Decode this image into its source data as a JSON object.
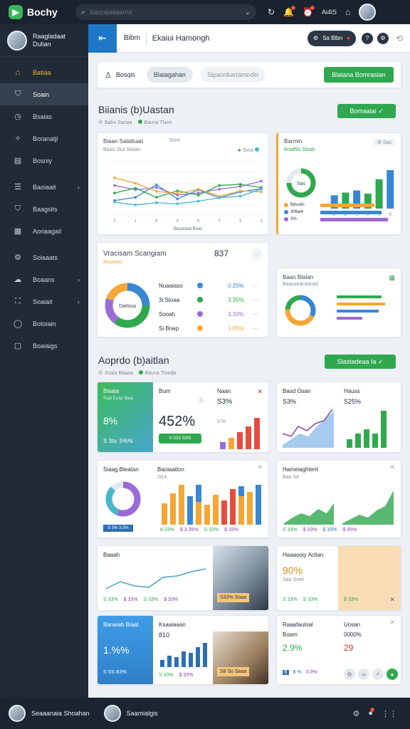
{
  "topbar": {
    "logo": "Bochy",
    "search_placeholder": "Sascaladaamd",
    "right_text": "Ai4lS"
  },
  "profile": {
    "name": "Raagladaat",
    "role": "Dulian"
  },
  "sidebar": {
    "items": [
      {
        "label": "Batiaa",
        "icon": "home-icon"
      },
      {
        "label": "Soain",
        "icon": "shield-icon"
      },
      {
        "label": "Bsaias",
        "icon": "clock-icon"
      },
      {
        "label": "Boranatji",
        "icon": "compass-icon"
      },
      {
        "label": "Bosniy",
        "icon": "chart-icon"
      },
      {
        "label": "Baoiaait",
        "icon": "layers-icon"
      },
      {
        "label": "Baagsits",
        "icon": "shield-icon"
      },
      {
        "label": "Aoriaagail",
        "icon": "calendar-icon"
      },
      {
        "label": "Solaaats",
        "icon": "settings-icon"
      },
      {
        "label": "Boaans",
        "icon": "cloud-icon"
      },
      {
        "label": "Soaiait",
        "icon": "gift-icon"
      },
      {
        "label": "Botoiain",
        "icon": "chat-icon"
      },
      {
        "label": "Boaiaigs",
        "icon": "doc-icon"
      }
    ]
  },
  "header": {
    "crumb": "Bibm",
    "title": "Ekaiui Hamongh",
    "pill_text": "Sa Bibn"
  },
  "filters": {
    "tab1": "Bosqis",
    "tab2": "Blaiagahan",
    "tab3": "Sipaorikartamodin",
    "button": "Blaiana Bomrasian"
  },
  "section1": {
    "title": "Biianis (b)Uastan",
    "button": "Bomaaiai",
    "legend": [
      "Babu Sanaa",
      "Bauna Tlass"
    ]
  },
  "line_card": {
    "title": "Biaan Salattuan",
    "subtitle": "Baaa Ska Stlaan",
    "right_label": "Stom",
    "legend": "Sksa",
    "axis_caption": "Busaoual Bsas"
  },
  "bar_card": {
    "title": "Barmin",
    "subtitle": "Bradfils Stsab",
    "pill": "Sas"
  },
  "bar_rows": [
    {
      "label": "Bdsoiin",
      "value": 0.76,
      "color": "#f4a735"
    },
    {
      "label": "306ai4",
      "value": 0.86,
      "color": "#3a86d3"
    },
    {
      "label": "3%",
      "value": 0.95,
      "color": "#9a6bd8"
    }
  ],
  "bar_axis": [
    "B",
    "B",
    "S",
    "8",
    "S",
    "8"
  ],
  "donut_card": {
    "title": "Vracisam Scangiam",
    "value": "837",
    "subtitle": "Bosaaicl",
    "center": "Dattosa"
  },
  "donut_rows": [
    {
      "name": "Nuaaiaso",
      "pct": "0 25%",
      "color": "#3a86d3"
    },
    {
      "name": "3i Stoaa",
      "pct": "3.35%",
      "color": "#2fa84f"
    },
    {
      "name": "Sooah",
      "pct": "3.33%",
      "color": "#9a6bd8"
    },
    {
      "name": "Si Bnep",
      "pct": "1.85%",
      "color": "#f4a735"
    }
  ],
  "mini_card": {
    "title": "Baan Blalan",
    "subtitle": "Baasseacadcad"
  },
  "section2": {
    "title": "Aoprdo (b)aitlan",
    "button": "Slastadeaa Ia",
    "legend": [
      "Ssaia Baaaa",
      "Bauna Tlooda"
    ]
  },
  "tiles": {
    "green": {
      "title": "Bisata",
      "subtitle": "Ssat Cusp Staa",
      "metric": "8%",
      "foot": "S 3to. 5%%"
    },
    "t2": {
      "title": "Bum",
      "metric": "452%",
      "button": "S S33 St3S"
    },
    "t3": {
      "title": "Naan",
      "metric": "S3%",
      "note": "3%",
      "pct": "0.%"
    },
    "t4": {
      "title": "Basd Osan",
      "metric": "S3%",
      "note": "Hauss",
      "pct": "S25%"
    },
    "t5": {
      "title": "Siaag Bleatan",
      "stat": "S 3% 3.3%"
    },
    "t6": {
      "title": "Baoiaatlon",
      "subtitle": "2i14",
      "stats": [
        "8 33%",
        "$ 3.35%",
        "S 33%",
        "$ 33%"
      ]
    },
    "t7": {
      "title": "Hameiaghtent",
      "subtitle": "Baa S8",
      "stats": [
        "S 33%",
        "$ 33%",
        "$ 33%",
        "$ 35%"
      ]
    },
    "t8": {
      "title": "Baaah",
      "stats": [
        "S 33%",
        "$ 33%",
        "S 33%",
        "$ 33%"
      ],
      "photo_caption": "S33% Soaa"
    },
    "t9": {
      "title": "Haaaooiy Aclian",
      "metric": "90%",
      "subtitle": "Saa Soiei",
      "stats": [
        "S 33%",
        "S 33%"
      ],
      "right": "$ 33%"
    },
    "t10": {
      "title": "Banaiah Biaat",
      "metric": "1.%%",
      "foot": "S SS B3%"
    },
    "t11": {
      "title": "Ksaaiaaan",
      "value": "810",
      "stats": [
        "S 33%",
        "$ 33%"
      ],
      "photo_caption": "S8 So Saaa"
    },
    "t12": {
      "title": "Raaafauloal",
      "name": "Boam",
      "metric": "2.9%",
      "right_title": "Uosan",
      "right_value": "0000%",
      "right_metric": "29",
      "stats": [
        "8 %",
        "3.0%"
      ]
    }
  },
  "bottom": {
    "user1": "Seaaanaia Shoahan",
    "user2": "Saamialgis"
  },
  "chart_data": [
    {
      "type": "line",
      "title": "Biaan Salattuan",
      "categories": [
        "5",
        "1",
        "6",
        "4",
        "8",
        "0",
        "3",
        "1"
      ],
      "series": [
        {
          "values": [
            56,
            48,
            52,
            38,
            42,
            49,
            54,
            64
          ],
          "color": "#9a6bd8"
        },
        {
          "values": [
            42,
            51,
            34,
            46,
            38,
            56,
            58,
            52
          ],
          "color": "#2fa84f"
        },
        {
          "values": [
            28,
            34,
            57,
            31,
            48,
            33,
            44,
            50
          ],
          "color": "#3a86d3"
        },
        {
          "values": [
            70,
            60,
            45,
            41,
            49,
            36,
            46,
            44
          ],
          "color": "#f4a735"
        },
        {
          "values": [
            25,
            20,
            24,
            22,
            27,
            33,
            36,
            49
          ],
          "color": "#48b8c8"
        }
      ],
      "ylim": [
        0,
        100
      ],
      "xlabel": "Busaoual Bsas"
    },
    {
      "type": "bar",
      "title": "Barmin",
      "categories": [
        "B",
        "B",
        "S",
        "8",
        "S",
        "8"
      ],
      "values": [
        25,
        30,
        34,
        28,
        55,
        72
      ],
      "colors": [
        "#3a86d3",
        "#2fa84f",
        "#3a86d3",
        "#2fa84f",
        "#2fa84f",
        "#3a86d3"
      ],
      "ylim": [
        0,
        80
      ]
    },
    {
      "type": "pie",
      "title": "Vracisam Scangiam",
      "values": [
        25,
        35,
        20,
        20
      ],
      "colors": [
        "#3a86d3",
        "#2fa84f",
        "#9a6bd8",
        "#f4a735"
      ]
    }
  ]
}
